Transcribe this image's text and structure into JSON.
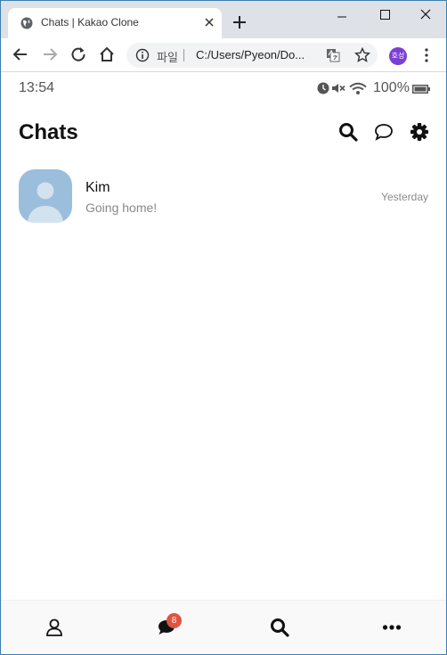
{
  "browser": {
    "tab_title": "Chats | Kakao Clone",
    "url_scheme_label": "파일",
    "url": "C:/Users/Pyeon/Do...",
    "profile_initials": "호성"
  },
  "status_bar": {
    "time": "13:54",
    "battery": "100%"
  },
  "header": {
    "title": "Chats"
  },
  "chats": [
    {
      "name": "Kim",
      "preview": "Going home!",
      "time": "Yesterday"
    }
  ],
  "tabbar": {
    "chats_badge": "8"
  },
  "colors": {
    "avatar_bg": "#9bbedd",
    "badge": "#e0533e",
    "profile": "#7b3fd6"
  }
}
